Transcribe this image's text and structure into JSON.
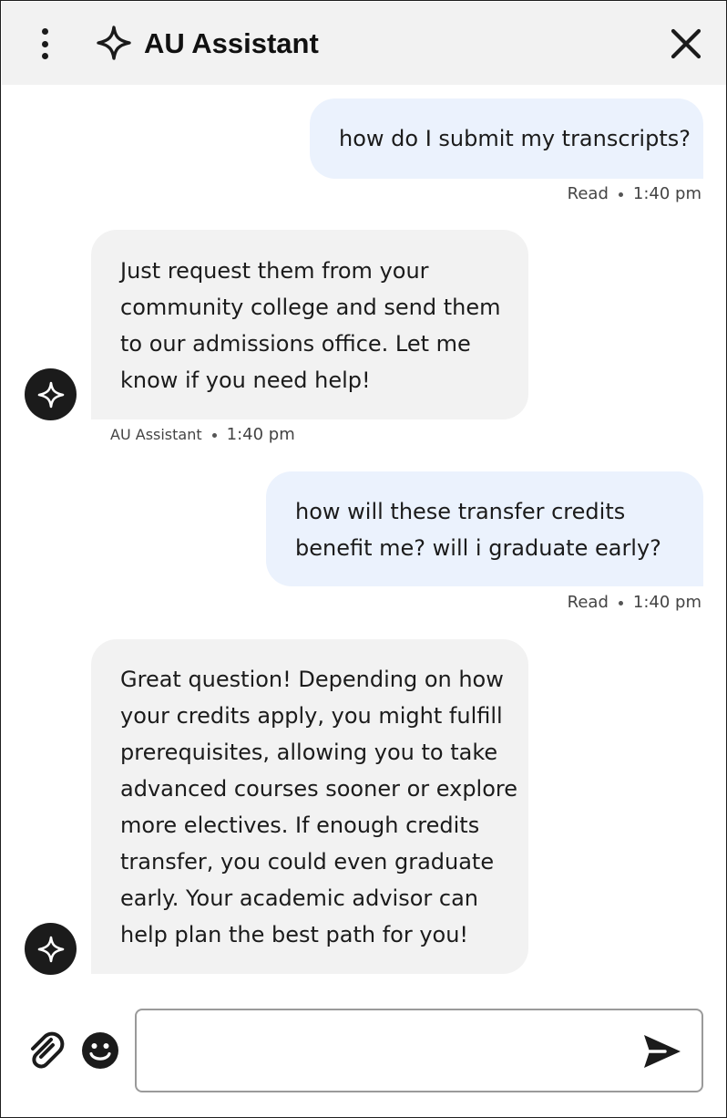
{
  "header": {
    "title": "AU Assistant",
    "menu_icon": "more-vertical-icon",
    "logo_icon": "sparkle-icon",
    "close_icon": "close-icon"
  },
  "colors": {
    "header_bg": "#f2f2f2",
    "user_bubble": "#ebf2fd",
    "bot_bubble": "#f2f2f2",
    "avatar_bg": "#1b1b1b"
  },
  "messages": [
    {
      "role": "user",
      "text": "how do I submit my transcripts?",
      "status": "Read",
      "time": "1:40 pm"
    },
    {
      "role": "assistant",
      "text": "Just request them from your\ncommunity college and send them\nto our admissions office. Let me\nknow if you need help!",
      "sender": "AU Assistant",
      "time": "1:40 pm"
    },
    {
      "role": "user",
      "text": "how will these transfer credits\nbenefit me? will i graduate early?",
      "status": "Read",
      "time": "1:40 pm"
    },
    {
      "role": "assistant",
      "text": "Great question! Depending on how\nyour credits apply, you might fulfill\nprerequisites, allowing you to take\nadvanced courses sooner or explore\nmore electives. If enough credits\ntransfer, you could even graduate\nearly. Your academic advisor can\nhelp plan the best path for you!"
    }
  ],
  "composer": {
    "value": "",
    "placeholder": "",
    "attach_icon": "paperclip-icon",
    "emoji_icon": "emoji-icon",
    "send_icon": "send-icon"
  }
}
